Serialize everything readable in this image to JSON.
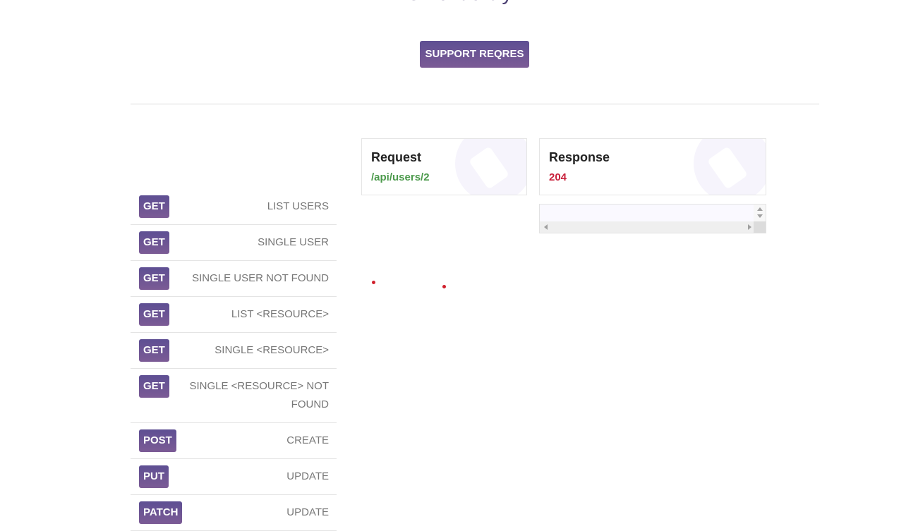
{
  "header": {
    "heading_fragment": "Give it a try",
    "support_button": "SUPPORT REQRES"
  },
  "endpoints": [
    {
      "method": "GET",
      "name": "LIST USERS"
    },
    {
      "method": "GET",
      "name": "SINGLE USER"
    },
    {
      "method": "GET",
      "name": "SINGLE USER NOT FOUND"
    },
    {
      "method": "GET",
      "name": "LIST <RESOURCE>"
    },
    {
      "method": "GET",
      "name": "SINGLE <RESOURCE>"
    },
    {
      "method": "GET",
      "name": "SINGLE <RESOURCE> NOT FOUND"
    },
    {
      "method": "POST",
      "name": "CREATE"
    },
    {
      "method": "PUT",
      "name": "UPDATE"
    },
    {
      "method": "PATCH",
      "name": "UPDATE"
    }
  ],
  "request": {
    "title": "Request",
    "url": "/api/users/2"
  },
  "response": {
    "title": "Response",
    "status": "204",
    "body": ""
  },
  "colors": {
    "accent": "#5e4f93",
    "request_url": "#4c9a4c",
    "response_status": "#c8203b"
  }
}
